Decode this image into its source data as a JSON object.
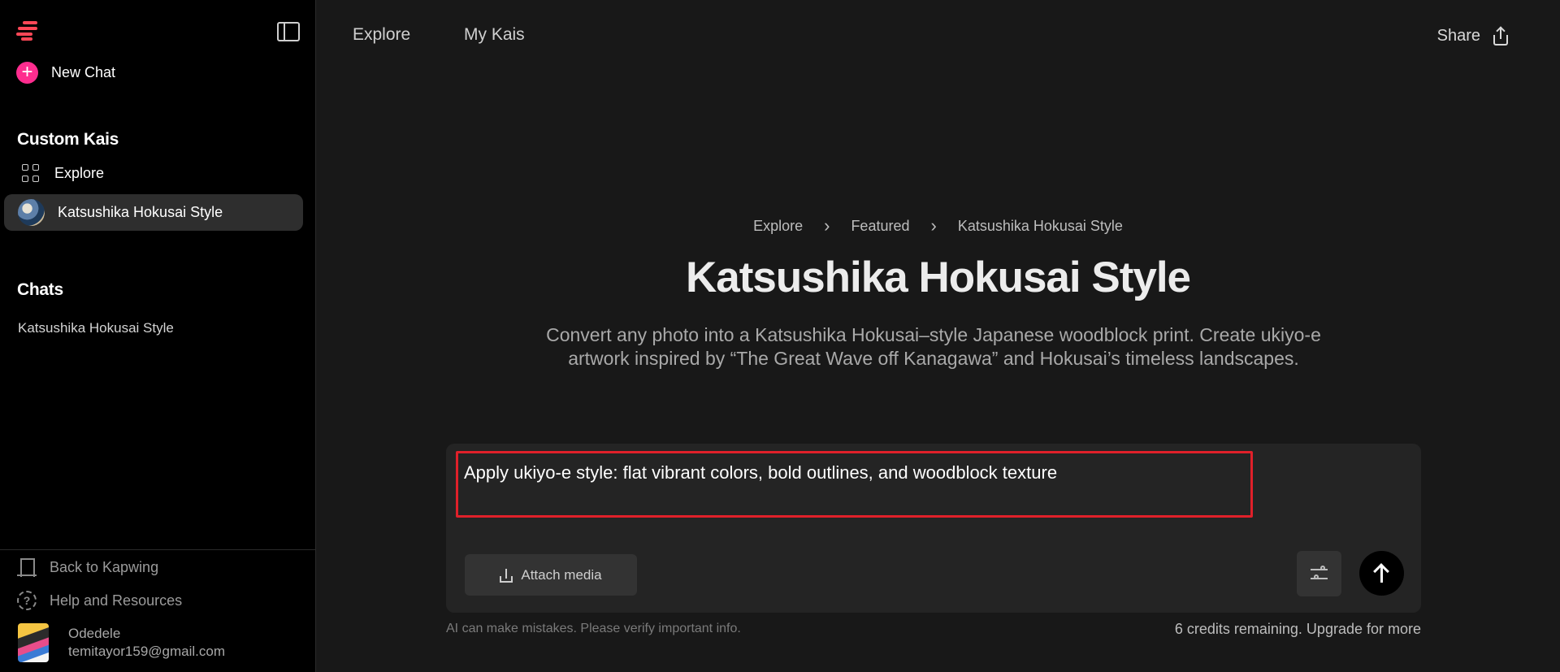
{
  "sidebar": {
    "new_chat": "New Chat",
    "custom_kais_title": "Custom Kais",
    "explore": "Explore",
    "active_kai": "Katsushika Hokusai Style",
    "chats_title": "Chats",
    "chats": [
      "Katsushika Hokusai Style"
    ],
    "back_link": "Back to Kapwing",
    "help_link": "Help and Resources",
    "user": {
      "name": "Odedele",
      "email": "temitayor159@gmail.com"
    }
  },
  "topnav": {
    "tabs": [
      "Explore",
      "My Kais"
    ],
    "share": "Share"
  },
  "main": {
    "breadcrumb": [
      "Explore",
      "Featured",
      "Katsushika Hokusai Style"
    ],
    "title": "Katsushika Hokusai Style",
    "description": "Convert any photo into a Katsushika Hokusai–style Japanese woodblock print. Create ukiyo-e artwork inspired by “The Great Wave off Kanagawa” and Hokusai’s timeless landscapes.",
    "prompt_value": "Apply ukiyo-e style: flat vibrant colors, bold outlines, and woodblock texture",
    "attach_media": "Attach media",
    "disclaimer": "AI can make mistakes. Please verify important info.",
    "credits": "6 credits remaining. Upgrade for more"
  },
  "colors": {
    "accent_pink": "#ff2d8f",
    "logo_red": "#ff4757",
    "highlight_border": "#e0202a",
    "background": "#181818",
    "sidebar_background": "#000000"
  },
  "icons": [
    "kapwing-logo-icon",
    "sidebar-toggle-icon",
    "plus-icon",
    "grid-icon",
    "door-icon",
    "help-icon",
    "share-icon",
    "upload-icon",
    "sliders-icon",
    "arrow-up-icon",
    "chevron-right-icon"
  ]
}
